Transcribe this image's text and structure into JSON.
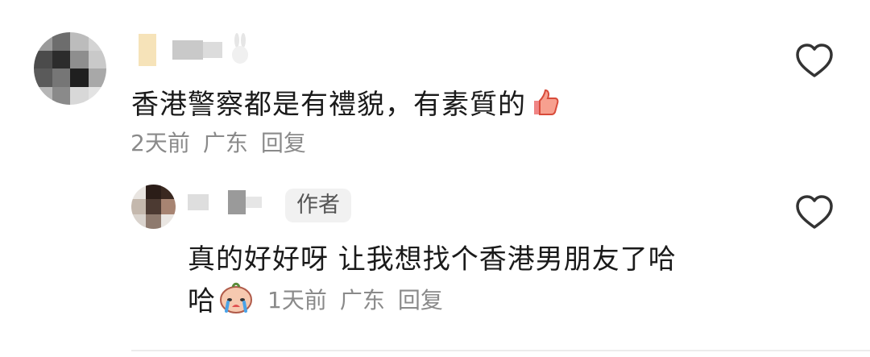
{
  "comments": [
    {
      "text": "香港警察都是有禮貌，有素質的",
      "time": "2天前",
      "location": "广东",
      "reply_label": "回复",
      "emoji_icon": "thumbs-up-icon",
      "like_icon": "heart-outline-icon"
    },
    {
      "author_badge": "作者",
      "text_line1": "真的好好呀 让我想找个香港男朋友了哈",
      "text_line2": "哈",
      "time": "1天前",
      "location": "广东",
      "reply_label": "回复",
      "emoji_icon": "crying-face-icon",
      "like_icon": "heart-outline-icon"
    }
  ],
  "colors": {
    "text": "#1a1a1a",
    "meta": "#8a8a8a",
    "badge_bg": "#f1f1f1",
    "divider": "#ececec"
  }
}
